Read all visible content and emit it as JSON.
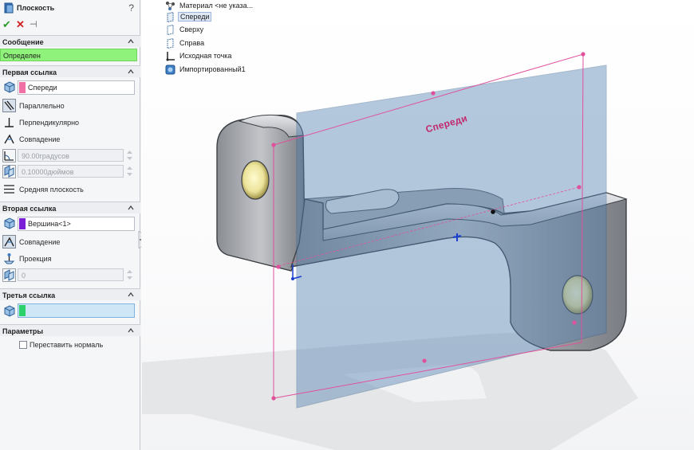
{
  "property_manager": {
    "title": "Плоскость",
    "help": "?",
    "actions": {
      "ok": "✔",
      "cancel": "✕",
      "pin": "⊣"
    },
    "message": {
      "header": "Сообщение",
      "text": "Определен"
    },
    "first_reference": {
      "header": "Первая ссылка",
      "selection": "Спереди",
      "selection_color": "#f06fa5",
      "options": {
        "parallel": "Параллельно",
        "perpendicular": "Перпендикулярно",
        "coincident": "Совпадение",
        "angle": "90.00градусов",
        "distance": "0.10000дюймов",
        "mid_plane": "Средняя плоскость"
      }
    },
    "second_reference": {
      "header": "Вторая ссылка",
      "selection": "Вершина<1>",
      "selection_color": "#7a1fd6",
      "options": {
        "coincident": "Совпадение",
        "projection": "Проекция",
        "count": "0"
      }
    },
    "third_reference": {
      "header": "Третья ссылка",
      "selection": "",
      "selection_color": "#2bd16a"
    },
    "parameters": {
      "header": "Параметры",
      "flip_normal": "Переставить нормаль",
      "flip_normal_checked": false
    }
  },
  "feature_tree": [
    {
      "label": "Материал <не указа...",
      "icon": "material-icon"
    },
    {
      "label": "Спереди",
      "icon": "plane-icon",
      "selected": true
    },
    {
      "label": "Сверху",
      "icon": "plane-icon"
    },
    {
      "label": "Справа",
      "icon": "plane-icon"
    },
    {
      "label": "Исходная точка",
      "icon": "origin-icon"
    },
    {
      "label": "Импортированный1",
      "icon": "imported-body-icon"
    }
  ],
  "viewport": {
    "plane_label": "Спереди",
    "preview_color": "#e0519b",
    "plane_color": "#4f7fb0"
  },
  "colors": {
    "message_ok": "#8ff27a",
    "accent_green": "#2e9d2e",
    "accent_red": "#d22020",
    "third_field_bg": "#cfe6f7"
  }
}
